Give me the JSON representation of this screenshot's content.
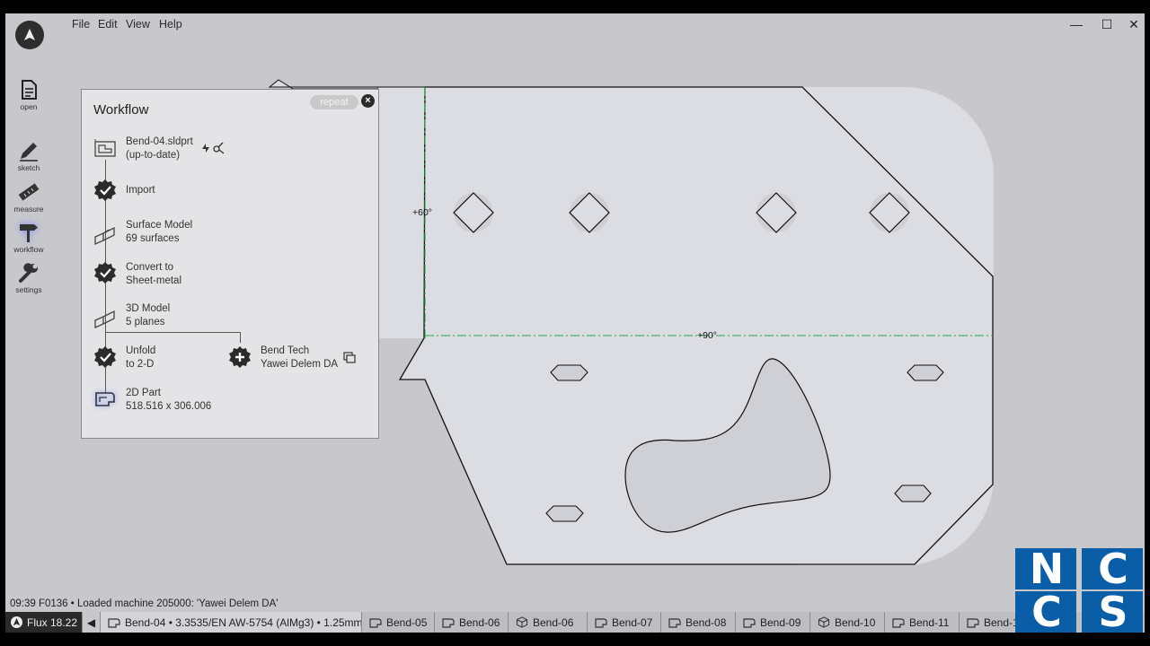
{
  "menu": {
    "file": "File",
    "edit": "Edit",
    "view": "View",
    "help": "Help"
  },
  "window": {
    "minimize": "—",
    "maximize": "☐",
    "close": "✕"
  },
  "rail": {
    "open": "open",
    "sketch": "sketch",
    "measure": "measure",
    "workflow": "workflow",
    "settings": "settings"
  },
  "workflow": {
    "title": "Workflow",
    "repeat": "repeat",
    "close": "×",
    "steps": [
      {
        "line1": "Bend-04.sldprt",
        "line2": "(up-to-date)"
      },
      {
        "line1": "Import",
        "line2": ""
      },
      {
        "line1": "Surface Model",
        "line2": "69 surfaces"
      },
      {
        "line1": "Convert to",
        "line2": "Sheet-metal"
      },
      {
        "line1": "3D Model",
        "line2": "5 planes"
      },
      {
        "line1": "Unfold",
        "line2": "to 2-D"
      },
      {
        "line1": "Bend Tech",
        "line2": "Yawei Delem DA"
      },
      {
        "line1": "2D Part",
        "line2": "518.516 x 306.006"
      }
    ]
  },
  "canvas": {
    "bend_labels": [
      "+60°",
      "+90°"
    ],
    "colors": {
      "sheet": "#dcdce3",
      "bend_line": "#2aa84a",
      "outline": "#111111"
    }
  },
  "status": "09:39  F0136 • Loaded machine 205000: 'Yawei Delem DA'",
  "taskbar": {
    "app": "Flux 18.22",
    "arrow": "◀",
    "active_doc": "Bend-04 • 3.3535/EN AW-5754 (AlMg3) • 1.25mm",
    "docs": [
      "Bend-05",
      "Bend-06",
      "Bend-06",
      "Bend-07",
      "Bend-08",
      "Bend-09",
      "Bend-10",
      "Bend-11",
      "Bend-1"
    ]
  },
  "watermark": {
    "letters": [
      "N",
      "C",
      "C",
      "S"
    ],
    "color": "#0a5ea8"
  }
}
